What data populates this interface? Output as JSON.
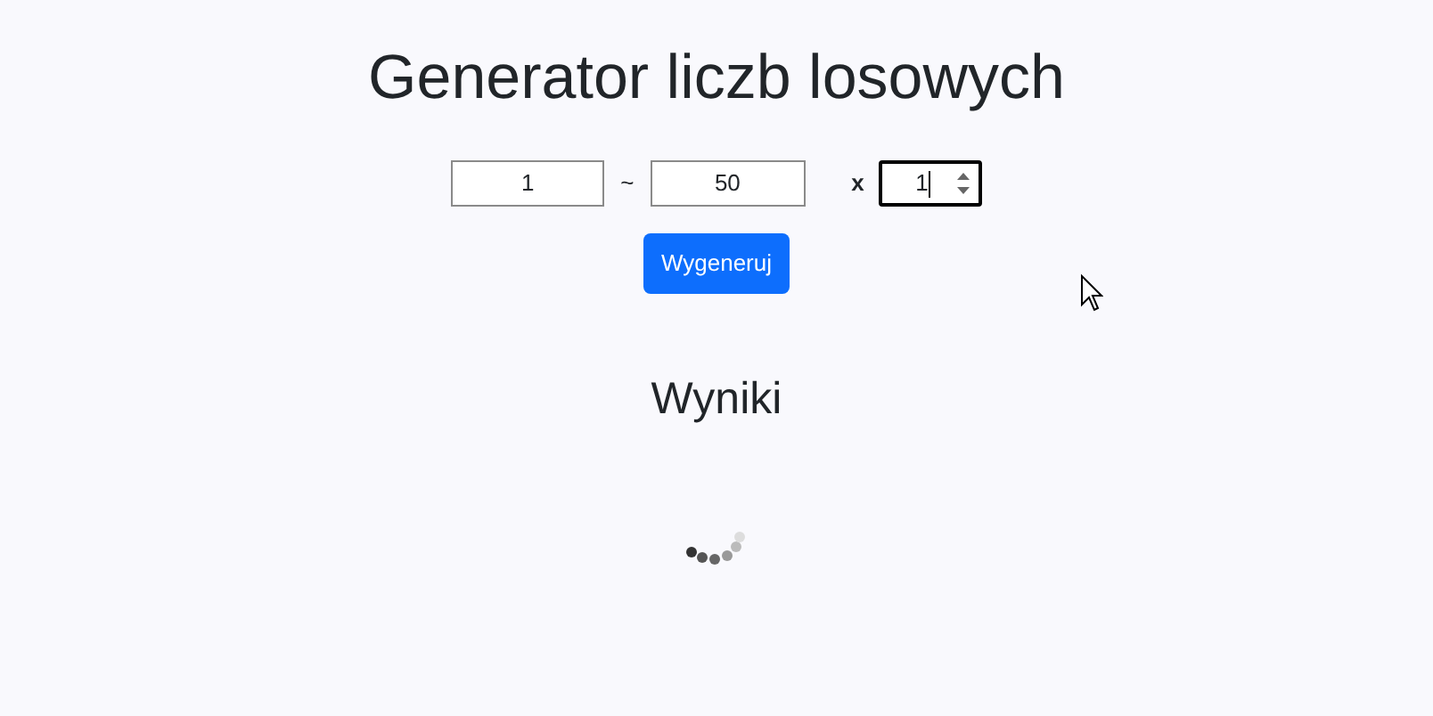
{
  "title": "Generator liczb losowych",
  "range": {
    "min": "1",
    "separator": "~",
    "max": "50",
    "times_label": "x",
    "count": "1",
    "count_focused": true
  },
  "generate_button": "Wygeneruj",
  "results": {
    "heading": "Wyniki",
    "loading": true
  }
}
